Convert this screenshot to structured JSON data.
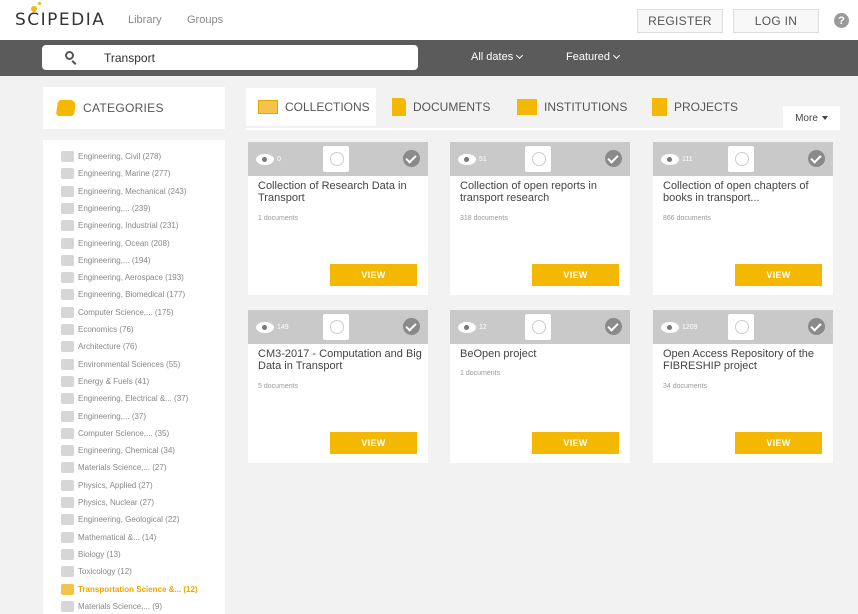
{
  "header": {
    "logo": "SCIPEDIA",
    "nav": [
      "Library",
      "Groups"
    ],
    "register_label": "REGISTER",
    "login_label": "LOG IN",
    "help_label": "?"
  },
  "search": {
    "value": "Transport",
    "placeholder": "",
    "filters": [
      "All dates",
      "Featured"
    ]
  },
  "categories": {
    "title": "CATEGORIES",
    "items": [
      "Engineering, Civil (278)",
      "Engineering, Marine (277)",
      "Engineering, Mechanical (243)",
      "Engineering,... (239)",
      "Engineering, Industrial (231)",
      "Engineering, Ocean (208)",
      "Engineering,... (194)",
      "Engineering, Aerospace (193)",
      "Engineering, Biomedical (177)",
      "Computer Science,... (175)",
      "Economics (76)",
      "Architecture (76)",
      "Environmental Sciences (55)",
      "Energy & Fuels (41)",
      "Engineering, Electrical &... (37)",
      "Engineering,... (37)",
      "Computer Science,... (35)",
      "Engineering, Chemical (34)",
      "Materials Science,... (27)",
      "Physics, Applied (27)",
      "Physics, Nuclear (27)",
      "Engineering, Geological (22)",
      "Mathematical &... (14)",
      "Biology (13)",
      "Toxicology (12)",
      "Transportation Science &... (12)",
      "Materials Science,... (9)"
    ],
    "active_index": 25
  },
  "tabs": [
    "COLLECTIONS",
    "DOCUMENTS",
    "INSTITUTIONS",
    "PROJECTS"
  ],
  "more_label": "More",
  "cards": [
    {
      "views": "0",
      "title": "Collection of Research Data in Transport",
      "count": "1 documents",
      "button": "VIEW"
    },
    {
      "views": "51",
      "title": "Collection of open reports in transport research",
      "count": "318 documents",
      "button": "VIEW"
    },
    {
      "views": "111",
      "title": "Collection of open chapters of books in transport...",
      "count": "866 documents",
      "button": "VIEW"
    },
    {
      "views": "149",
      "title": "CM3-2017 - Computation and Big Data in Transport",
      "count": "5 documents",
      "button": "VIEW"
    },
    {
      "views": "12",
      "title": "BeOpen project",
      "count": "1 documents",
      "button": "VIEW"
    },
    {
      "views": "1209",
      "title": "Open Access Repository of the FIBRESHIP project",
      "count": "34 documents",
      "button": "VIEW"
    }
  ]
}
